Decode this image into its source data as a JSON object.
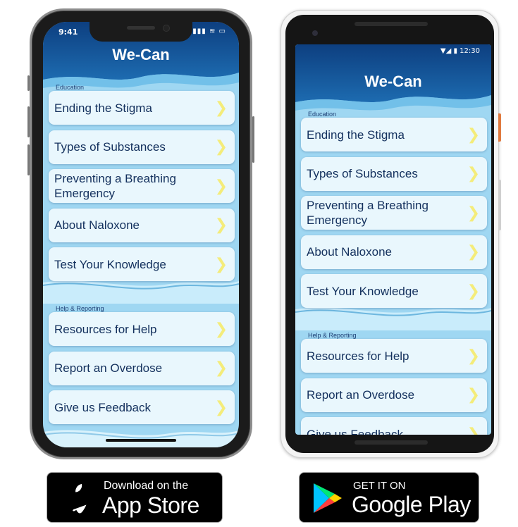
{
  "app": {
    "title": "We-Can",
    "sections": [
      {
        "label": "Education",
        "items": [
          {
            "label": "Ending the Stigma"
          },
          {
            "label": "Types of Substances"
          },
          {
            "label": "Preventing a Breathing Emergency"
          },
          {
            "label": "About Naloxone"
          },
          {
            "label": "Test Your Knowledge"
          }
        ]
      },
      {
        "label": "Help & Reporting",
        "items": [
          {
            "label": "Resources for Help"
          },
          {
            "label": "Report an Overdose"
          },
          {
            "label": "Give us Feedback"
          }
        ]
      }
    ],
    "chevron": "❯"
  },
  "iphone": {
    "status_time": "9:41"
  },
  "android": {
    "status_time": "12:30"
  },
  "badges": {
    "appstore": {
      "small": "Download on the",
      "big": "App Store"
    },
    "googleplay": {
      "small": "GET IT ON",
      "big": "Google Play"
    }
  },
  "colors": {
    "header_dark": "#0d3f80",
    "header_mid": "#1d6bb0",
    "background_light": "#9fd7f2",
    "card": "#e9f7fd",
    "card_text": "#13305d",
    "chevron": "#f4ec7a"
  }
}
